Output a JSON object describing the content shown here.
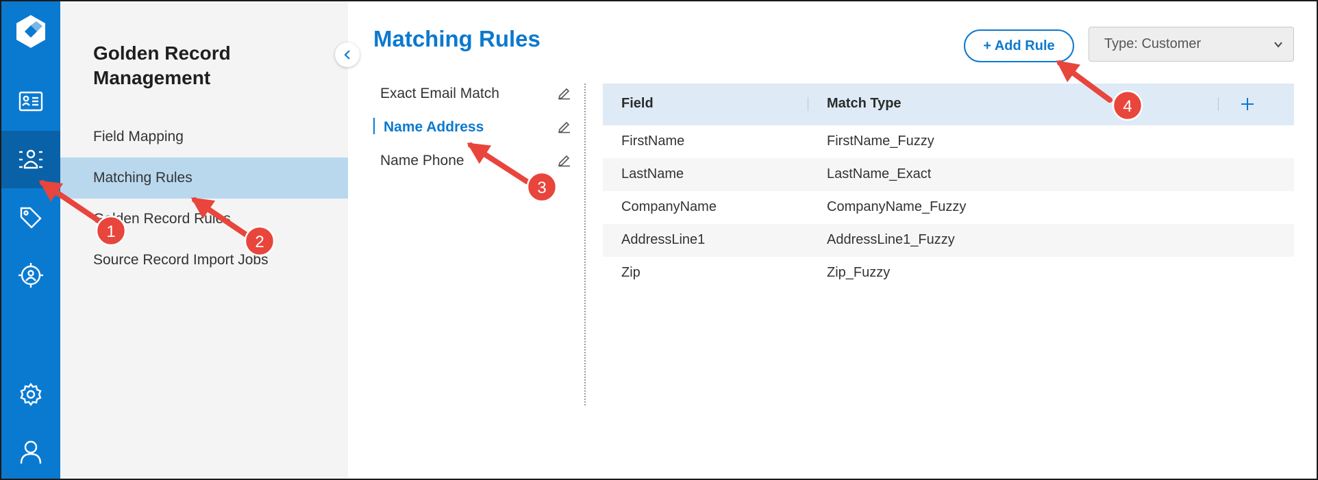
{
  "rail": {
    "items": [
      {
        "name": "logo-icon"
      },
      {
        "name": "contact-card-icon"
      },
      {
        "name": "people-network-icon"
      },
      {
        "name": "tag-icon"
      },
      {
        "name": "target-person-icon"
      },
      {
        "name": "gear-icon"
      },
      {
        "name": "user-icon"
      }
    ]
  },
  "subnav": {
    "title": "Golden Record Management",
    "items": [
      {
        "label": "Field Mapping"
      },
      {
        "label": "Matching Rules"
      },
      {
        "label": "Golden Record Rules"
      },
      {
        "label": "Source Record Import Jobs"
      }
    ]
  },
  "main": {
    "title": "Matching Rules",
    "add_rule_label": "+ Add Rule",
    "type_select_value": "Type: Customer",
    "rules": [
      {
        "label": "Exact Email Match"
      },
      {
        "label": "Name Address"
      },
      {
        "label": "Name Phone"
      }
    ],
    "table": {
      "headers": [
        "Field",
        "Match Type"
      ],
      "rows": [
        {
          "field": "FirstName",
          "match_type": "FirstName_Fuzzy"
        },
        {
          "field": "LastName",
          "match_type": "LastName_Exact"
        },
        {
          "field": "CompanyName",
          "match_type": "CompanyName_Fuzzy"
        },
        {
          "field": "AddressLine1",
          "match_type": "AddressLine1_Fuzzy"
        },
        {
          "field": "Zip",
          "match_type": "Zip_Fuzzy"
        }
      ]
    }
  },
  "annotations": [
    "1",
    "2",
    "3",
    "4"
  ],
  "colors": {
    "rail": "#0a7ad1",
    "rail_active": "#0962a8",
    "accent": "#0b79cf",
    "subnav_active": "#b9d8ee",
    "table_header": "#deeaf5",
    "annotation_red": "#e8453c"
  }
}
